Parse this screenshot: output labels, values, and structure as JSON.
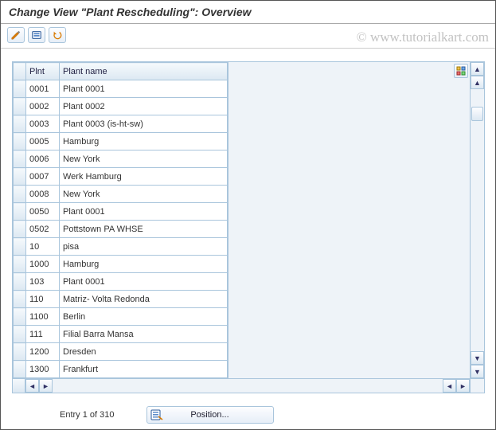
{
  "title": "Change View \"Plant Rescheduling\": Overview",
  "watermark": "© www.tutorialkart.com",
  "columns": {
    "sel": "",
    "plnt": "Plnt",
    "name": "Plant name"
  },
  "rows": [
    {
      "plnt": "0001",
      "name": "Plant 0001"
    },
    {
      "plnt": "0002",
      "name": "Plant 0002"
    },
    {
      "plnt": "0003",
      "name": "Plant 0003 (is-ht-sw)"
    },
    {
      "plnt": "0005",
      "name": "Hamburg"
    },
    {
      "plnt": "0006",
      "name": "New York"
    },
    {
      "plnt": "0007",
      "name": "Werk Hamburg"
    },
    {
      "plnt": "0008",
      "name": "New York"
    },
    {
      "plnt": "0050",
      "name": "Plant 0001"
    },
    {
      "plnt": "0502",
      "name": "Pottstown PA WHSE"
    },
    {
      "plnt": "10",
      "name": "pisa"
    },
    {
      "plnt": "1000",
      "name": "Hamburg"
    },
    {
      "plnt": "103",
      "name": "Plant 0001"
    },
    {
      "plnt": "110",
      "name": "Matriz- Volta Redonda"
    },
    {
      "plnt": "1100",
      "name": "Berlin"
    },
    {
      "plnt": "111",
      "name": "Filial Barra Mansa"
    },
    {
      "plnt": "1200",
      "name": "Dresden"
    },
    {
      "plnt": "1300",
      "name": "Frankfurt"
    }
  ],
  "footer": {
    "entry_label": "Entry 1 of 310",
    "position_label": "Position..."
  }
}
